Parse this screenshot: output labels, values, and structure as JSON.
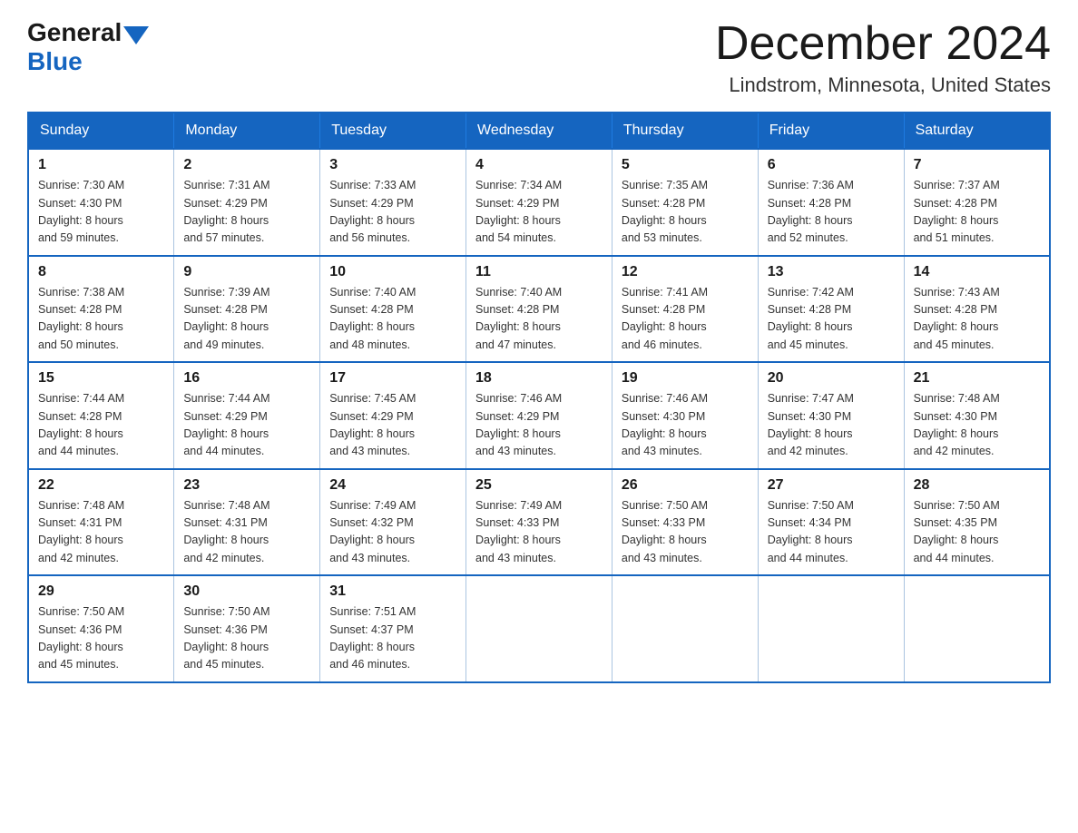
{
  "header": {
    "logo_general": "General",
    "logo_blue": "Blue",
    "month_title": "December 2024",
    "location": "Lindstrom, Minnesota, United States"
  },
  "days_of_week": [
    "Sunday",
    "Monday",
    "Tuesday",
    "Wednesday",
    "Thursday",
    "Friday",
    "Saturday"
  ],
  "weeks": [
    [
      {
        "day": "1",
        "sunrise": "7:30 AM",
        "sunset": "4:30 PM",
        "daylight": "8 hours and 59 minutes."
      },
      {
        "day": "2",
        "sunrise": "7:31 AM",
        "sunset": "4:29 PM",
        "daylight": "8 hours and 57 minutes."
      },
      {
        "day": "3",
        "sunrise": "7:33 AM",
        "sunset": "4:29 PM",
        "daylight": "8 hours and 56 minutes."
      },
      {
        "day": "4",
        "sunrise": "7:34 AM",
        "sunset": "4:29 PM",
        "daylight": "8 hours and 54 minutes."
      },
      {
        "day": "5",
        "sunrise": "7:35 AM",
        "sunset": "4:28 PM",
        "daylight": "8 hours and 53 minutes."
      },
      {
        "day": "6",
        "sunrise": "7:36 AM",
        "sunset": "4:28 PM",
        "daylight": "8 hours and 52 minutes."
      },
      {
        "day": "7",
        "sunrise": "7:37 AM",
        "sunset": "4:28 PM",
        "daylight": "8 hours and 51 minutes."
      }
    ],
    [
      {
        "day": "8",
        "sunrise": "7:38 AM",
        "sunset": "4:28 PM",
        "daylight": "8 hours and 50 minutes."
      },
      {
        "day": "9",
        "sunrise": "7:39 AM",
        "sunset": "4:28 PM",
        "daylight": "8 hours and 49 minutes."
      },
      {
        "day": "10",
        "sunrise": "7:40 AM",
        "sunset": "4:28 PM",
        "daylight": "8 hours and 48 minutes."
      },
      {
        "day": "11",
        "sunrise": "7:40 AM",
        "sunset": "4:28 PM",
        "daylight": "8 hours and 47 minutes."
      },
      {
        "day": "12",
        "sunrise": "7:41 AM",
        "sunset": "4:28 PM",
        "daylight": "8 hours and 46 minutes."
      },
      {
        "day": "13",
        "sunrise": "7:42 AM",
        "sunset": "4:28 PM",
        "daylight": "8 hours and 45 minutes."
      },
      {
        "day": "14",
        "sunrise": "7:43 AM",
        "sunset": "4:28 PM",
        "daylight": "8 hours and 45 minutes."
      }
    ],
    [
      {
        "day": "15",
        "sunrise": "7:44 AM",
        "sunset": "4:28 PM",
        "daylight": "8 hours and 44 minutes."
      },
      {
        "day": "16",
        "sunrise": "7:44 AM",
        "sunset": "4:29 PM",
        "daylight": "8 hours and 44 minutes."
      },
      {
        "day": "17",
        "sunrise": "7:45 AM",
        "sunset": "4:29 PM",
        "daylight": "8 hours and 43 minutes."
      },
      {
        "day": "18",
        "sunrise": "7:46 AM",
        "sunset": "4:29 PM",
        "daylight": "8 hours and 43 minutes."
      },
      {
        "day": "19",
        "sunrise": "7:46 AM",
        "sunset": "4:30 PM",
        "daylight": "8 hours and 43 minutes."
      },
      {
        "day": "20",
        "sunrise": "7:47 AM",
        "sunset": "4:30 PM",
        "daylight": "8 hours and 42 minutes."
      },
      {
        "day": "21",
        "sunrise": "7:48 AM",
        "sunset": "4:30 PM",
        "daylight": "8 hours and 42 minutes."
      }
    ],
    [
      {
        "day": "22",
        "sunrise": "7:48 AM",
        "sunset": "4:31 PM",
        "daylight": "8 hours and 42 minutes."
      },
      {
        "day": "23",
        "sunrise": "7:48 AM",
        "sunset": "4:31 PM",
        "daylight": "8 hours and 42 minutes."
      },
      {
        "day": "24",
        "sunrise": "7:49 AM",
        "sunset": "4:32 PM",
        "daylight": "8 hours and 43 minutes."
      },
      {
        "day": "25",
        "sunrise": "7:49 AM",
        "sunset": "4:33 PM",
        "daylight": "8 hours and 43 minutes."
      },
      {
        "day": "26",
        "sunrise": "7:50 AM",
        "sunset": "4:33 PM",
        "daylight": "8 hours and 43 minutes."
      },
      {
        "day": "27",
        "sunrise": "7:50 AM",
        "sunset": "4:34 PM",
        "daylight": "8 hours and 44 minutes."
      },
      {
        "day": "28",
        "sunrise": "7:50 AM",
        "sunset": "4:35 PM",
        "daylight": "8 hours and 44 minutes."
      }
    ],
    [
      {
        "day": "29",
        "sunrise": "7:50 AM",
        "sunset": "4:36 PM",
        "daylight": "8 hours and 45 minutes."
      },
      {
        "day": "30",
        "sunrise": "7:50 AM",
        "sunset": "4:36 PM",
        "daylight": "8 hours and 45 minutes."
      },
      {
        "day": "31",
        "sunrise": "7:51 AM",
        "sunset": "4:37 PM",
        "daylight": "8 hours and 46 minutes."
      },
      null,
      null,
      null,
      null
    ]
  ]
}
